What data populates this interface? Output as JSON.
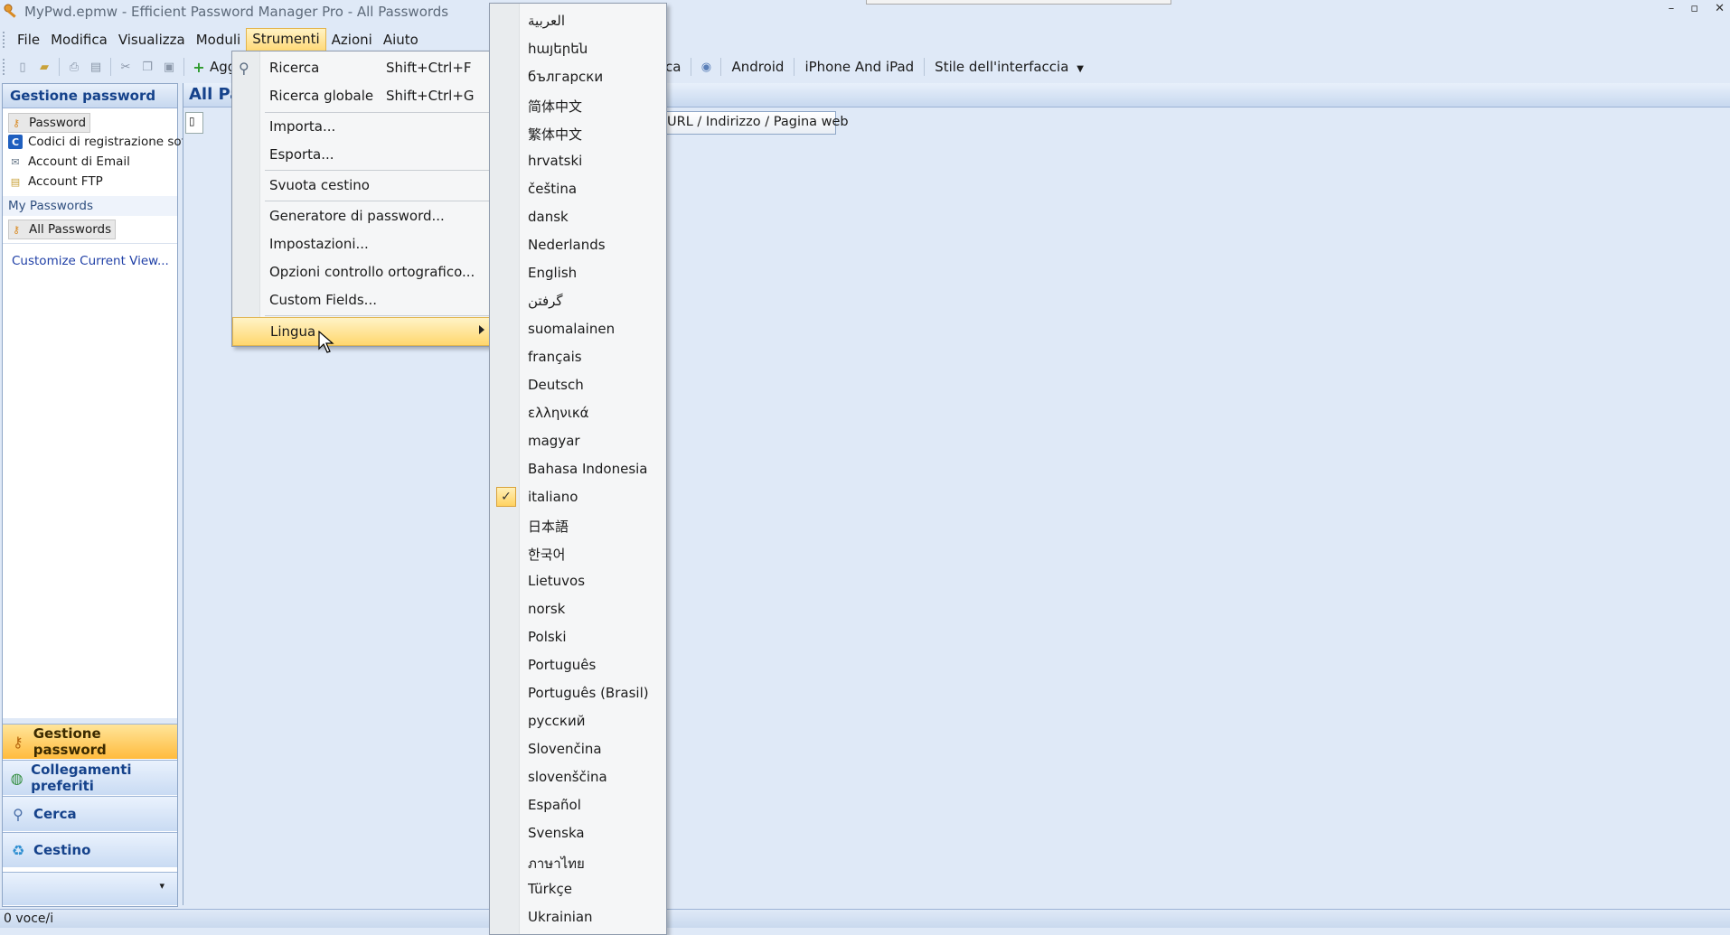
{
  "window": {
    "title": "MyPwd.epmw - Efficient Password Manager Pro - All Passwords",
    "icon": "key-icon",
    "controls": [
      "–",
      "▫",
      "✕"
    ]
  },
  "menubar": {
    "items": [
      "File",
      "Modifica",
      "Visualizza",
      "Moduli",
      "Strumenti",
      "Azioni",
      "Aiuto"
    ],
    "active": "Strumenti"
  },
  "toolbar": {
    "add_label": "Aggi",
    "partial_label": "ca",
    "android_label": "Android",
    "iphone_label": "iPhone And iPad",
    "style_label": "Stile dell'interfaccia"
  },
  "left_panel": {
    "header": "Gestione password",
    "tree_items": [
      {
        "label": "Password",
        "icon": "key-icon"
      },
      {
        "label": "Codici di registrazione soft",
        "icon": "code-icon"
      },
      {
        "label": "Account di Email",
        "icon": "email-icon"
      },
      {
        "label": "Account FTP",
        "icon": "ftp-icon"
      }
    ],
    "group_header": "My Passwords",
    "group_item": "All Passwords",
    "customize_link": "Customize Current View...",
    "nav_buttons": [
      {
        "label": "Gestione password",
        "icon": "key-icon"
      },
      {
        "label": "Collegamenti preferiti",
        "icon": "globe-icon"
      },
      {
        "label": "Cerca",
        "icon": "search-icon"
      },
      {
        "label": "Cestino",
        "icon": "recycle-icon"
      }
    ]
  },
  "main": {
    "title": "All Pa",
    "url_column": "URL / Indirizzo / Pagina web"
  },
  "status": {
    "text": "0 voce/i"
  },
  "tools_menu": {
    "items": [
      {
        "label": "Ricerca",
        "shortcut": "Shift+Ctrl+F"
      },
      {
        "label": "Ricerca globale",
        "shortcut": "Shift+Ctrl+G"
      },
      {
        "label": "Importa..."
      },
      {
        "label": "Esporta..."
      },
      {
        "label": "Svuota cestino"
      },
      {
        "label": "Generatore di password..."
      },
      {
        "label": "Impostazioni..."
      },
      {
        "label": "Opzioni controllo ortografico..."
      },
      {
        "label": "Custom Fields..."
      },
      {
        "label": "Lingua"
      }
    ]
  },
  "language_menu": {
    "items": [
      "العربية",
      "հայերեն",
      "български",
      "简体中文",
      "繁体中文",
      "hrvatski",
      "čeština",
      "dansk",
      "Nederlands",
      "English",
      "گرفتن",
      "suomalainen",
      "français",
      "Deutsch",
      "ελληνικά",
      "magyar",
      "Bahasa Indonesia",
      "italiano",
      "日本語",
      "한국어",
      "Lietuvos",
      "norsk",
      "Polski",
      "Português",
      "Português (Brasil)",
      "русский",
      "Slovenčina",
      "slovenščina",
      "Español",
      "Svenska",
      "ภาษาไทย",
      "Türkçe",
      "Ukrainian"
    ],
    "checked": "italiano",
    "checkmark": "✓"
  },
  "colors": {
    "accent": "#ffd76e",
    "header_text": "#15428b",
    "background": "#dfe9f7"
  }
}
